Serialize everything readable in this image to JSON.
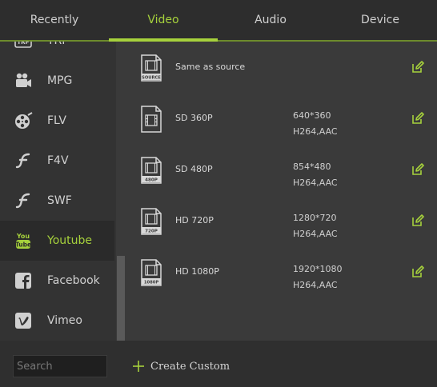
{
  "tabs": [
    "Recently",
    "Video",
    "Audio",
    "Device"
  ],
  "active_tab": "Video",
  "accent_color": "#a6d13c",
  "sidebar": {
    "items": [
      {
        "label": "TRP",
        "icon": "trp-icon"
      },
      {
        "label": "MPG",
        "icon": "video-camera-icon"
      },
      {
        "label": "FLV",
        "icon": "film-reel-icon"
      },
      {
        "label": "F4V",
        "icon": "flash-icon"
      },
      {
        "label": "SWF",
        "icon": "flash-icon"
      },
      {
        "label": "Youtube",
        "icon": "youtube-icon"
      },
      {
        "label": "Facebook",
        "icon": "facebook-icon"
      },
      {
        "label": "Vimeo",
        "icon": "vimeo-icon"
      }
    ],
    "active_item": "Youtube"
  },
  "presets": [
    {
      "name": "Same as source",
      "badge": "SOURCE",
      "resolution": "",
      "codec": ""
    },
    {
      "name": "SD 360P",
      "badge": "",
      "resolution": "640*360",
      "codec": "H264,AAC"
    },
    {
      "name": "SD 480P",
      "badge": "480P",
      "resolution": "854*480",
      "codec": "H264,AAC"
    },
    {
      "name": "HD 720P",
      "badge": "720P",
      "resolution": "1280*720",
      "codec": "H264,AAC"
    },
    {
      "name": "HD 1080P",
      "badge": "1080P",
      "resolution": "1920*1080",
      "codec": "H264,AAC"
    }
  ],
  "search": {
    "placeholder": "Search",
    "value": ""
  },
  "create_custom_label": "Create Custom"
}
